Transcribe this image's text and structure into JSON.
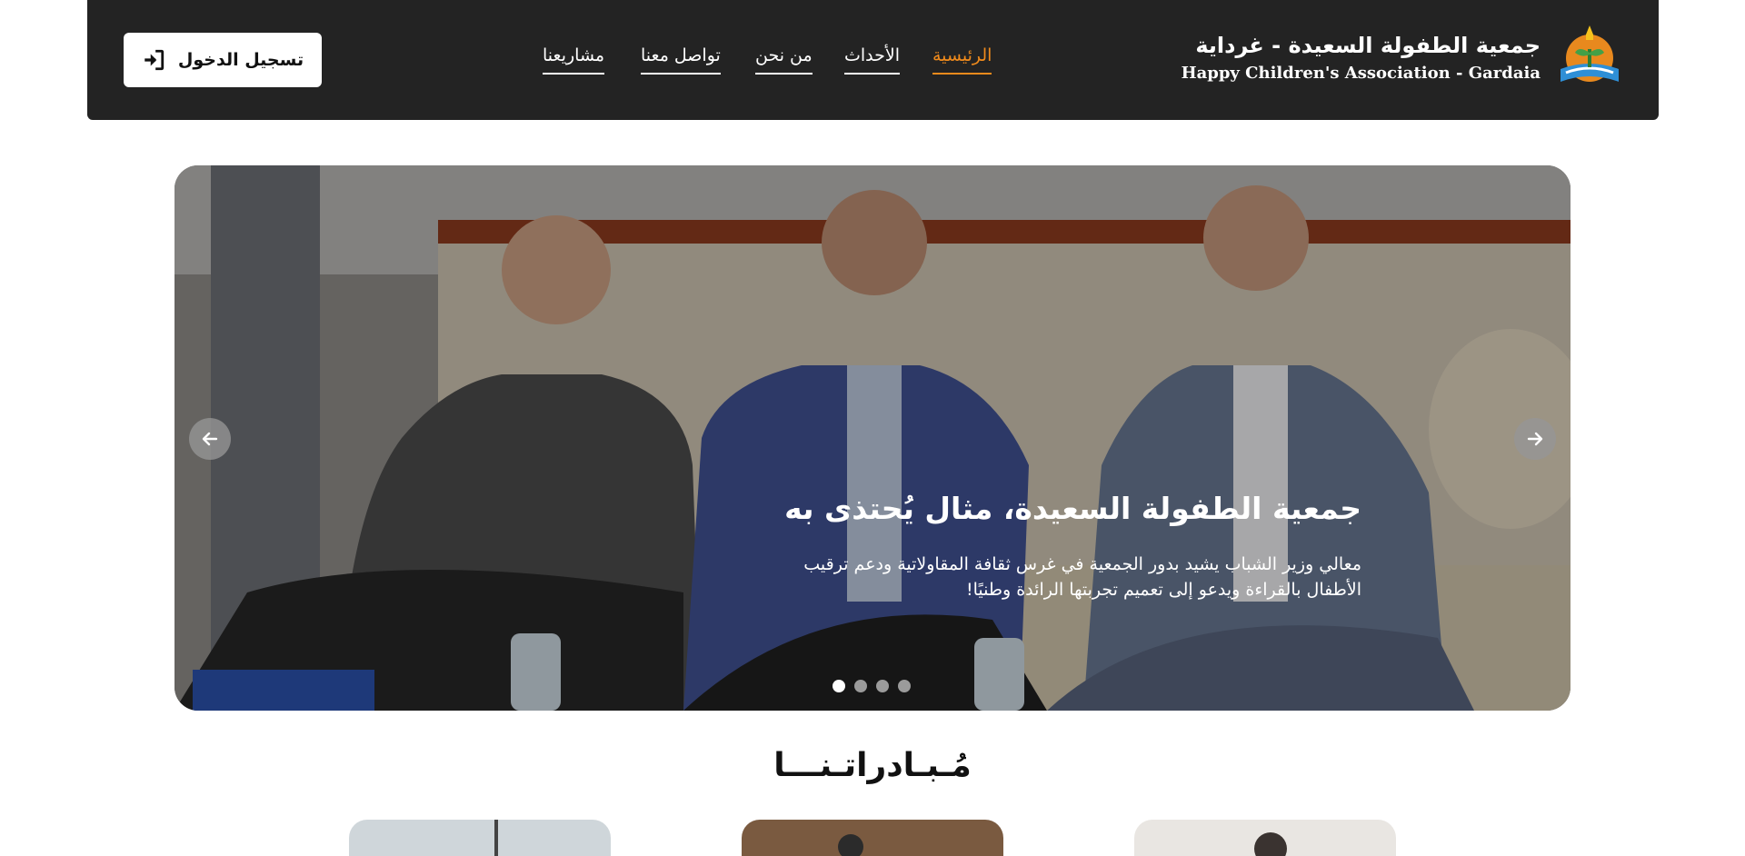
{
  "header": {
    "brand_ar": "جمعية الطفولة السعيدة - غرداية",
    "brand_en": "Happy Children's Association - Gardaia",
    "logo_icon": "association-logo-icon",
    "nav": [
      {
        "label": "الرئيسية",
        "active": true
      },
      {
        "label": "الأحداث",
        "active": false
      },
      {
        "label": "من نحن",
        "active": false
      },
      {
        "label": "تواصل معنا",
        "active": false
      },
      {
        "label": "مشاريعنا",
        "active": false
      }
    ],
    "login_label": "تسجيل الدخول",
    "login_icon": "sign-in-icon"
  },
  "hero": {
    "title": "جمعية الطفولة السعيدة، مثال يُحتذى به",
    "description": "معالي وزير الشباب يشيد بدور الجمعية في غرس ثقافة المقاولاتية ودعم ترقيب الأطفال بالقراءة ويدعو إلى تعميم تجربتها الرائدة وطنيًا!",
    "prev_icon": "arrow-left-icon",
    "next_icon": "arrow-right-icon",
    "slide_count": 4,
    "active_slide": 1
  },
  "initiatives": {
    "title": "مُـبـادراتـنـــا"
  },
  "colors": {
    "header_bg": "#232323",
    "accent": "#ef8a1c"
  }
}
